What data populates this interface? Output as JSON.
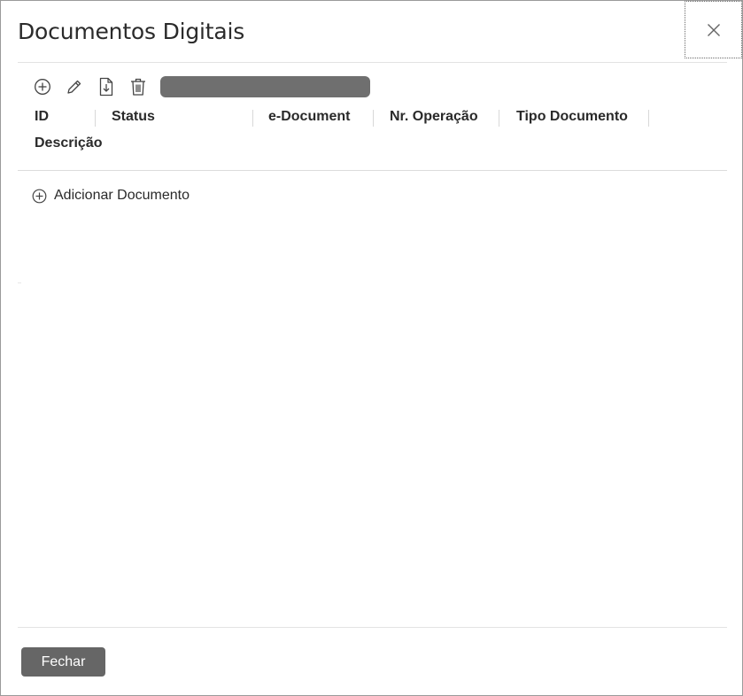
{
  "dialog": {
    "title": "Documentos Digitais"
  },
  "toolbar": {
    "icons": [
      "add-circle-icon",
      "pencil-icon",
      "document-download-icon",
      "trash-icon"
    ],
    "search_value": ""
  },
  "grid": {
    "columns": [
      "ID",
      "Status",
      "e-Document",
      "Nr. Operação",
      "Tipo Documento",
      "Descrição"
    ]
  },
  "add_row": {
    "label": "Adicionar Documento",
    "icon": "add-circle-icon"
  },
  "footer": {
    "close_label": "Fechar"
  },
  "colors": {
    "button_bg": "#666666",
    "search_bg": "#6f6f6f",
    "border": "#9a9a9a"
  }
}
